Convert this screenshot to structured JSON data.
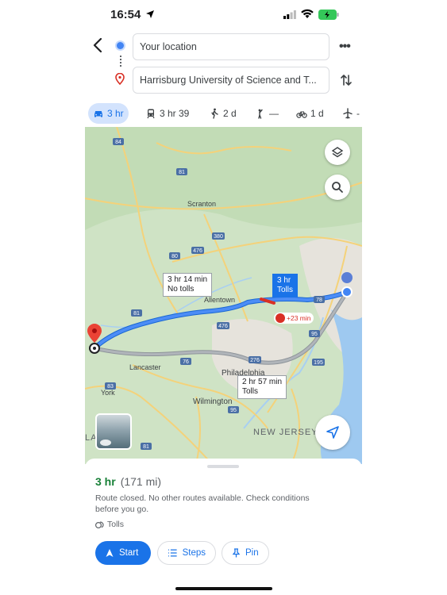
{
  "status_bar": {
    "time": "16:54"
  },
  "directions": {
    "from_value": "Your location",
    "to_value": "Harrisburg University of Science and T..."
  },
  "modes": [
    {
      "name": "drive",
      "label": "3 hr"
    },
    {
      "name": "transit",
      "label": "3 hr 39"
    },
    {
      "name": "walk",
      "label": "2 d"
    },
    {
      "name": "ride",
      "label": "—"
    },
    {
      "name": "bike",
      "label": "1 d"
    },
    {
      "name": "flight",
      "label": "-"
    }
  ],
  "map": {
    "labels": {
      "scranton": "Scranton",
      "allentown": "Allentown",
      "philadelphia": "Philadelphia",
      "lancaster": "Lancaster",
      "york": "York",
      "wilmington": "Wilmington",
      "new_jersey": "NEW JERSEY",
      "la": "LA"
    },
    "shields": [
      "84",
      "81",
      "380",
      "80",
      "476",
      "78",
      "476",
      "81",
      "276",
      "95",
      "195",
      "76",
      "83",
      "81",
      "95"
    ],
    "callouts": {
      "alt1_time": "3 hr 14 min",
      "alt1_note": "No tolls",
      "main_time": "3 hr",
      "main_note": "Tolls",
      "alt2_time": "2 hr 57 min",
      "alt2_note": "Tolls"
    },
    "delay": "+23 min"
  },
  "sheet": {
    "duration": "3 hr",
    "distance": "(171 mi)",
    "note": "Route closed. No other routes available. Check conditions before you go.",
    "tolls": "Tolls",
    "start_label": "Start",
    "steps_label": "Steps",
    "pin_label": "Pin"
  },
  "colors": {
    "accent": "#1a73e8",
    "duration_green": "#188038",
    "route_main": "#4285f4",
    "route_alt": "#9aa0a6",
    "closure_red": "#d93025"
  }
}
